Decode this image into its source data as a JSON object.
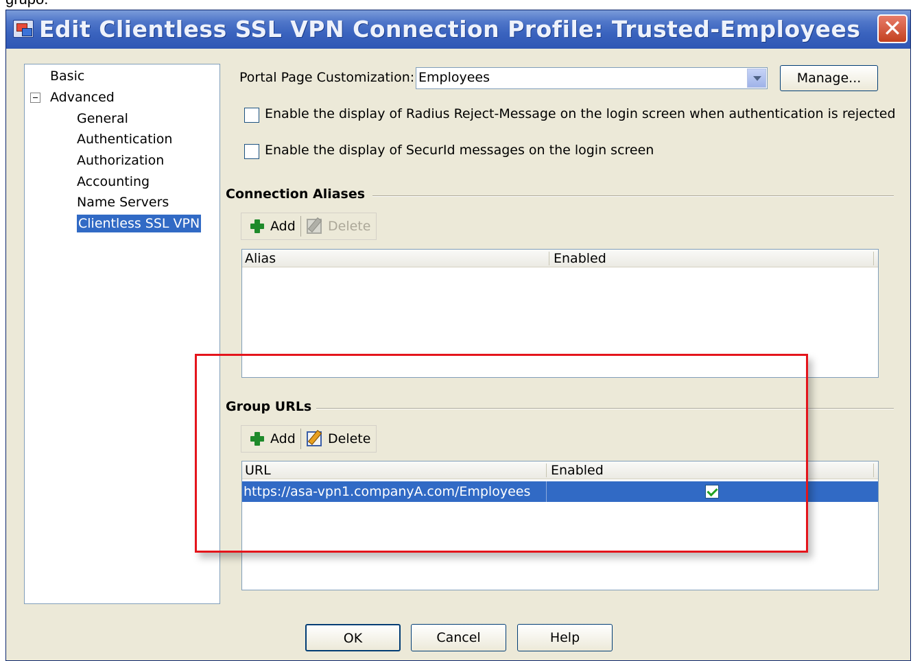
{
  "window": {
    "title": "Edit Clientless SSL VPN Connection Profile: Trusted-Employees",
    "caption_fragment": "grupo."
  },
  "nav": {
    "items": [
      {
        "label": "Basic"
      },
      {
        "label": "Advanced"
      },
      {
        "label": "General"
      },
      {
        "label": "Authentication"
      },
      {
        "label": "Authorization"
      },
      {
        "label": "Accounting"
      },
      {
        "label": "Name Servers"
      },
      {
        "label": "Clientless SSL VPN",
        "selected": true
      }
    ]
  },
  "portal": {
    "label": "Portal Page Customization:",
    "value": "Employees",
    "manage_label": "Manage..."
  },
  "options": {
    "radius_reject_label": "Enable the display of Radius Reject-Message on the login screen when authentication is rejected",
    "radius_reject_checked": false,
    "securid_label": "Enable the display of SecurId messages on the login screen",
    "securid_checked": false
  },
  "aliases": {
    "title": "Connection Aliases",
    "add_label": "Add",
    "delete_label": "Delete",
    "columns": [
      "Alias",
      "Enabled"
    ],
    "rows": []
  },
  "group_urls": {
    "title": "Group URLs",
    "add_label": "Add",
    "delete_label": "Delete",
    "columns": [
      "URL",
      "Enabled"
    ],
    "rows": [
      {
        "url": "https://asa-vpn1.companyA.com/Employees",
        "enabled": true
      }
    ]
  },
  "footer": {
    "ok_label": "OK",
    "cancel_label": "Cancel",
    "help_label": "Help"
  },
  "colors": {
    "titlebar": "#3a63be",
    "selection": "#316ac5",
    "highlight": "#e4141b",
    "dialog_bg": "#ece9d8"
  }
}
